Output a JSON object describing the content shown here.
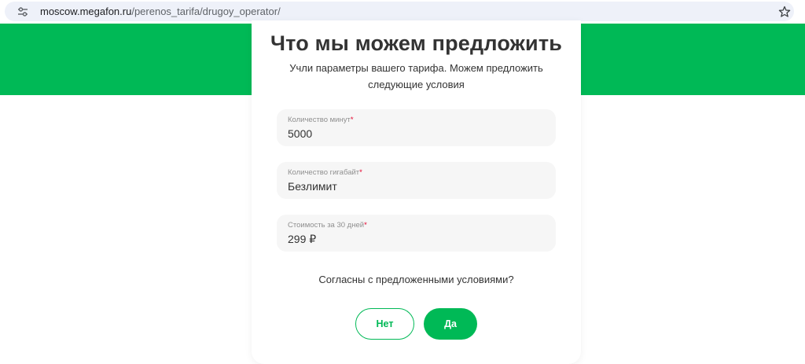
{
  "browser": {
    "url_host": "moscow.megafon.ru",
    "url_path": "/perenos_tarifa/drugoy_operator/",
    "site_info_icon": "tune-icon",
    "bookmark_icon": "star-icon"
  },
  "colors": {
    "brand_green": "#00b956",
    "required_red": "#e4002b"
  },
  "offer": {
    "title": "Что мы можем предложить",
    "subtitle": "Учли параметры вашего тарифа. Можем предложить следующие условия",
    "fields": [
      {
        "label": "Количество минут",
        "required_mark": "*",
        "value": "5000"
      },
      {
        "label": "Количество гигабайт",
        "required_mark": "*",
        "value": "Безлимит"
      },
      {
        "label": "Стоимость за 30 дней",
        "required_mark": "*",
        "value": "299 ₽"
      }
    ],
    "question": "Согласны с предложенными условиями?",
    "no_label": "Нет",
    "yes_label": "Да"
  }
}
